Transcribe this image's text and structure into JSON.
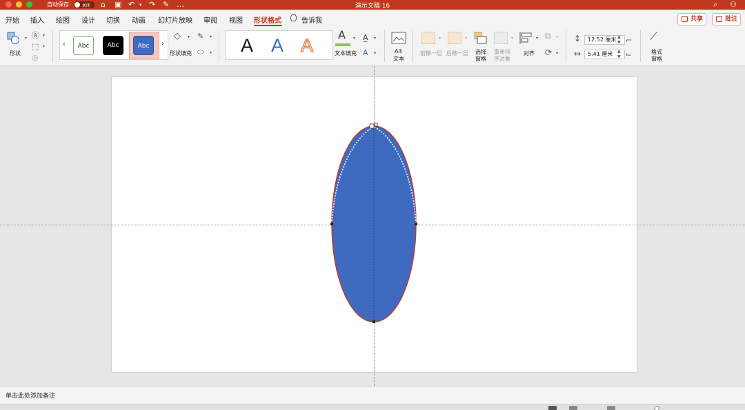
{
  "titlebar": {
    "autosave_label": "自动保存",
    "autosave_state": "关闭",
    "doc_title": "演示文稿 16"
  },
  "menu": {
    "tabs": [
      "开始",
      "插入",
      "绘图",
      "设计",
      "切换",
      "动画",
      "幻灯片放映",
      "审阅",
      "视图",
      "形状格式",
      "告诉我"
    ],
    "active_tab": "形状格式",
    "share_label": "共享",
    "comment_label": "批注"
  },
  "ribbon": {
    "shape_label": "形状",
    "style_samples": [
      "Abc",
      "Abc",
      "Abc"
    ],
    "shape_fill_label": "形状填充",
    "wordart_samples": [
      "A",
      "A",
      "A"
    ],
    "text_fill_label": "文本填充",
    "alt_text_label_1": "Alt",
    "alt_text_label_2": "文本",
    "bring_forward_label": "前移一层",
    "send_backward_label": "后移一层",
    "selection_pane_label_1": "选择",
    "selection_pane_label_2": "窗格",
    "reorder_label_1": "重新排",
    "reorder_label_2": "序对象",
    "align_label": "对齐",
    "height_value": "12.52 厘米",
    "width_value": "5.41 厘米",
    "format_pane_label_1": "格式",
    "format_pane_label_2": "窗格"
  },
  "shape": {
    "fill_color": "#3e6bbf",
    "outline_color": "#c0392b"
  },
  "notes": {
    "placeholder": "单击此处添加备注"
  },
  "colors": {
    "accent": "#c0391e",
    "titlebar": "#c0391e"
  }
}
